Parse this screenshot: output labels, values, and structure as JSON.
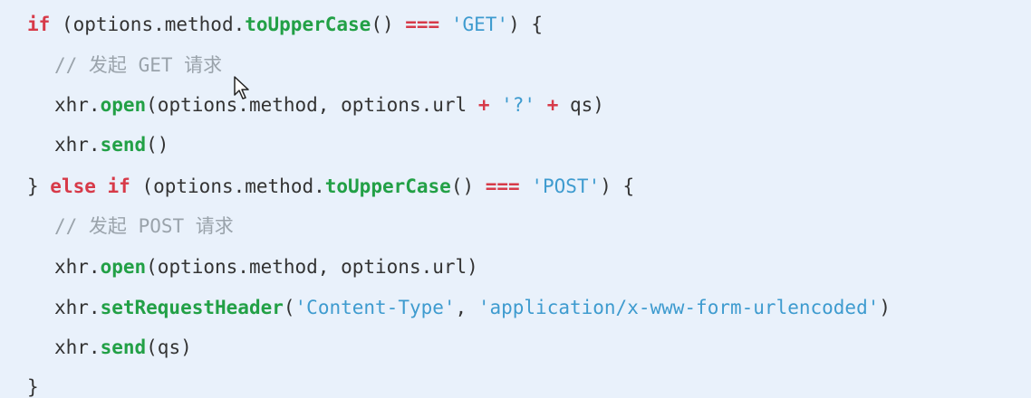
{
  "code": {
    "lines": [
      {
        "indent": 30,
        "tokens": [
          {
            "text": "if",
            "kind": "kw"
          },
          {
            "text": " (options.method.",
            "kind": "pl"
          },
          {
            "text": "toUpperCase",
            "kind": "fn"
          },
          {
            "text": "() ",
            "kind": "pl"
          },
          {
            "text": "===",
            "kind": "op"
          },
          {
            "text": " ",
            "kind": "pl"
          },
          {
            "text": "'GET'",
            "kind": "str"
          },
          {
            "text": ") {",
            "kind": "pl"
          }
        ]
      },
      {
        "indent": 60,
        "tokens": [
          {
            "text": "// 发起 GET 请求",
            "kind": "cm"
          }
        ]
      },
      {
        "indent": 60,
        "tokens": [
          {
            "text": "xhr.",
            "kind": "pl"
          },
          {
            "text": "open",
            "kind": "fn"
          },
          {
            "text": "(options.method, options.url ",
            "kind": "pl"
          },
          {
            "text": "+",
            "kind": "op"
          },
          {
            "text": " ",
            "kind": "pl"
          },
          {
            "text": "'?'",
            "kind": "str"
          },
          {
            "text": " ",
            "kind": "pl"
          },
          {
            "text": "+",
            "kind": "op"
          },
          {
            "text": " qs)",
            "kind": "pl"
          }
        ]
      },
      {
        "indent": 60,
        "tokens": [
          {
            "text": "xhr.",
            "kind": "pl"
          },
          {
            "text": "send",
            "kind": "fn"
          },
          {
            "text": "()",
            "kind": "pl"
          }
        ]
      },
      {
        "indent": 30,
        "tokens": [
          {
            "text": "} ",
            "kind": "pl"
          },
          {
            "text": "else if",
            "kind": "kw"
          },
          {
            "text": " (options.method.",
            "kind": "pl"
          },
          {
            "text": "toUpperCase",
            "kind": "fn"
          },
          {
            "text": "() ",
            "kind": "pl"
          },
          {
            "text": "===",
            "kind": "op"
          },
          {
            "text": " ",
            "kind": "pl"
          },
          {
            "text": "'POST'",
            "kind": "str"
          },
          {
            "text": ") {",
            "kind": "pl"
          }
        ]
      },
      {
        "indent": 60,
        "tokens": [
          {
            "text": "// 发起 POST 请求",
            "kind": "cm"
          }
        ]
      },
      {
        "indent": 60,
        "tokens": [
          {
            "text": "xhr.",
            "kind": "pl"
          },
          {
            "text": "open",
            "kind": "fn"
          },
          {
            "text": "(options.method, options.url)",
            "kind": "pl"
          }
        ]
      },
      {
        "indent": 60,
        "tokens": [
          {
            "text": "xhr.",
            "kind": "pl"
          },
          {
            "text": "setRequestHeader",
            "kind": "fn"
          },
          {
            "text": "(",
            "kind": "pl"
          },
          {
            "text": "'Content-Type'",
            "kind": "str"
          },
          {
            "text": ", ",
            "kind": "pl"
          },
          {
            "text": "'application/x-www-form-urlencoded'",
            "kind": "str"
          },
          {
            "text": ")",
            "kind": "pl"
          }
        ]
      },
      {
        "indent": 60,
        "tokens": [
          {
            "text": "xhr.",
            "kind": "pl"
          },
          {
            "text": "send",
            "kind": "fn"
          },
          {
            "text": "(qs)",
            "kind": "pl"
          }
        ]
      },
      {
        "indent": 30,
        "tokens": [
          {
            "text": "}",
            "kind": "pl"
          }
        ]
      }
    ]
  },
  "colors": {
    "background": "#e9f1fb",
    "keyword": "#d73a49",
    "function": "#22a046",
    "string": "#3e9bcf",
    "comment": "#9aa3ab",
    "plain": "#333333"
  },
  "cursor": {
    "icon": "mouse-pointer-icon"
  }
}
